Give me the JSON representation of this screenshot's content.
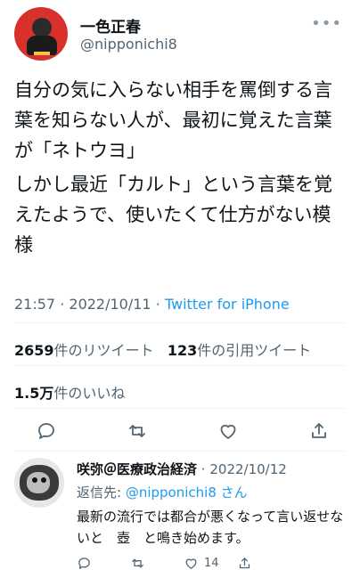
{
  "author": {
    "name": "一色正春",
    "handle": "@nipponichi8"
  },
  "tweet": {
    "paragraphs": [
      "自分の気に入らない相手を罵倒する言葉を知らない人が、最初に覚えた言葉が「ネトウヨ」",
      "しかし最近「カルト」という言葉を覚えたようで、使いたくて仕方がない模様"
    ],
    "time": "21:57",
    "separator": "·",
    "date": "2022/10/11",
    "source": "Twitter for iPhone"
  },
  "stats": {
    "retweets_count": "2659",
    "retweets_label": "件のリツイート",
    "quotes_count": "123",
    "quotes_label": "件の引用ツイート",
    "likes_count": "1.5万",
    "likes_label": "件のいいね"
  },
  "actions": {
    "icons": [
      "reply-icon",
      "retweet-icon",
      "like-icon",
      "share-icon"
    ]
  },
  "reply": {
    "name": "咲弥＠医療政治経済",
    "date": "2022/10/12",
    "reply_prefix": "返信先: ",
    "mention": "@nipponichi8",
    "mention_suffix": " さん",
    "text": "最新の流行では都合が悪くなって言い返せないと　壺　と鳴き始めます。",
    "like_count": "14"
  },
  "colors": {
    "accent": "#1d9bf0",
    "secondary_text": "#536471",
    "avatar_bg": "#d8302a"
  }
}
